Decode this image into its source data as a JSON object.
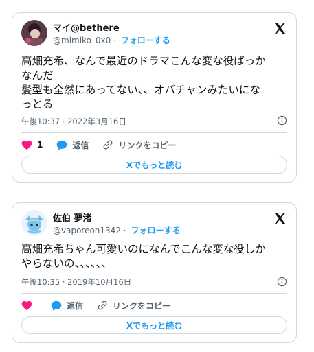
{
  "tweets": [
    {
      "display_name": "マイ@bethere",
      "handle": "@mimiko_0x0",
      "separator": "·",
      "follow_label": "フォローする",
      "text": "高畑充希、なんで最近のドラマこんな変な役ばっか\nなんだ\n髪型も全然にあってない、、オバチャンみたいにな\nっとる",
      "timestamp": "午後10:37 · 2022年3月16日",
      "like_count": "1",
      "reply_label": "返信",
      "copy_link_label": "リンクをコピー",
      "read_more_label": "Xでもっと読む"
    },
    {
      "display_name": "佐伯 夢渚",
      "handle": "@vaporeon1342",
      "separator": "·",
      "follow_label": "フォローする",
      "text": "高畑充希ちゃん可愛いのになんでこんな変な役しか\nやらないの、、、、、、",
      "timestamp": "午後10:35 · 2019年10月16日",
      "like_count": "",
      "reply_label": "返信",
      "copy_link_label": "リンクをコピー",
      "read_more_label": "Xでもっと読む"
    }
  ],
  "colors": {
    "accent": "#1d9bf0",
    "like": "#f91880",
    "text": "#0f1419",
    "muted": "#536471",
    "border": "#cfd9de"
  },
  "icons": [
    "x-logo-icon",
    "info-icon",
    "heart-icon",
    "reply-bubble-icon",
    "link-icon"
  ]
}
